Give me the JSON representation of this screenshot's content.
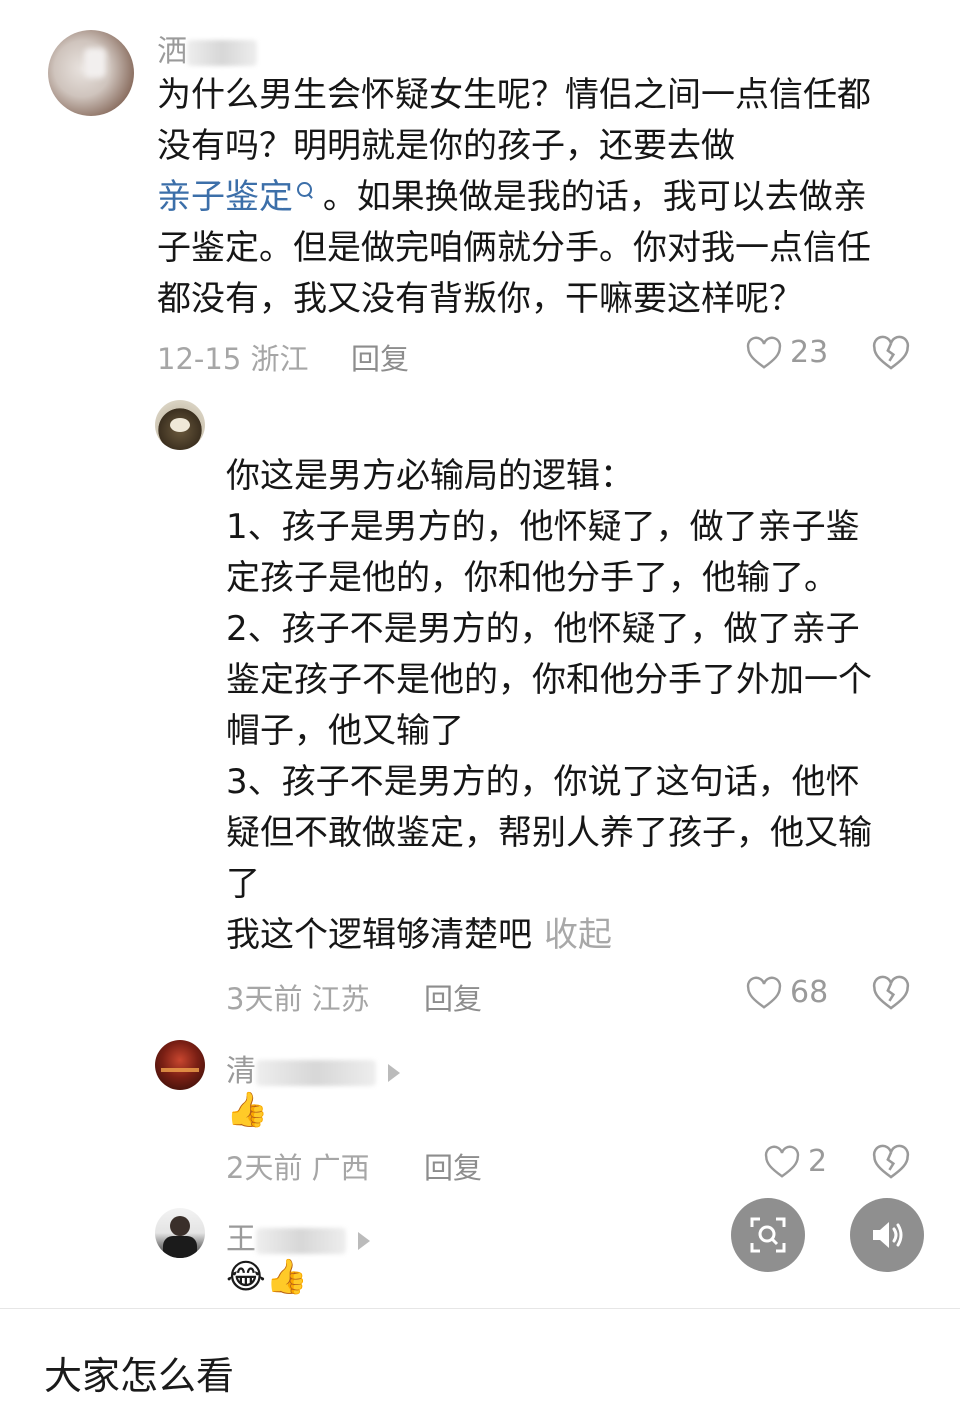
{
  "colors": {
    "text": "#161616",
    "meta": "#a6a6a6",
    "link": "#3c6fa9",
    "fab": "#8f8f8f"
  },
  "comments": [
    {
      "name_visible": "洒",
      "avatar_icon": "avatar-photo",
      "lines_before_link": [
        "为什么男生会怀疑女生呢？情侣之间一点信任都",
        "没有吗？明明就是你的孩子，还要去做"
      ],
      "link_text": "亲子鉴定",
      "link_line_rest": "。如果换做是我的话，我可以去做亲",
      "lines_after_link": [
        "子鉴定。但是做完咱俩就分手。你对我一点信任",
        "都没有，我又没有背叛你，干嘛要这样呢？"
      ],
      "date": "12-15",
      "location": "浙江",
      "reply_label": "回复",
      "likes": "23"
    },
    {
      "avatar_icon": "avatar-cartoon",
      "lines": [
        "你这是男方必输局的逻辑：",
        "1、孩子是男方的，他怀疑了，做了亲子鉴",
        "定孩子是他的，你和他分手了，他输了。",
        "2、孩子不是男方的，他怀疑了，做了亲子",
        "鉴定孩子不是他的，你和他分手了外加一个",
        "帽子，他又输了",
        "3、孩子不是男方的，你说了这句话，他怀",
        "疑但不敢做鉴定，帮别人养了孩子，他又输",
        "了"
      ],
      "last_line": "我这个逻辑够清楚吧",
      "collapse_label": "收起",
      "date": "3天前",
      "location": "江苏",
      "reply_label": "回复",
      "likes": "68"
    },
    {
      "name_visible": "清",
      "avatar_icon": "avatar-night-scene",
      "emoji": "👍",
      "date": "2天前",
      "location": "广西",
      "reply_label": "回复",
      "likes": "2"
    },
    {
      "name_visible": "王",
      "avatar_icon": "avatar-person",
      "emoji": "😂👍"
    }
  ],
  "buttons": {
    "scan_icon": "scan-search-icon",
    "sound_icon": "speaker-icon"
  },
  "caption": "大家怎么看"
}
